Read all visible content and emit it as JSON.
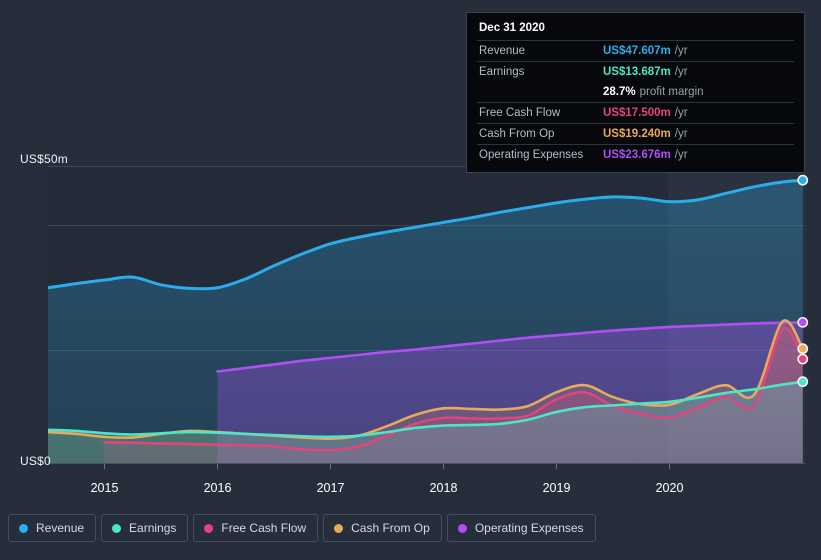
{
  "colors": {
    "background": "#262e3c",
    "plot_background": "#242b38",
    "forecast_background": "#2b3240",
    "gridline": "#3c4455",
    "revenue": "#2badeb",
    "earnings": "#4fe5c4",
    "free_cash_flow": "#e0457b",
    "cash_from_op": "#e8a95c",
    "operating_expenses": "#b14ef5",
    "tooltip_background": "#07080c",
    "tooltip_border": "#3b4253"
  },
  "y_axis": {
    "top_label": "US$50m",
    "zero_label": "US$0",
    "min": 0,
    "max": 50,
    "gridlines": [
      50,
      40,
      19,
      0
    ]
  },
  "x_axis": {
    "ticks": [
      "2015",
      "2016",
      "2017",
      "2018",
      "2019",
      "2020"
    ]
  },
  "tooltip": {
    "title": "Dec 31 2020",
    "rows": [
      {
        "key": "Revenue",
        "value": "US$47.607m",
        "unit": "/yr",
        "color": "#2badeb"
      },
      {
        "key": "Earnings",
        "value": "US$13.687m",
        "unit": "/yr",
        "color": "#4fe5c4"
      },
      {
        "key": "",
        "value": "28.7%",
        "unit": "profit margin",
        "color": "#ffffff"
      },
      {
        "key": "Free Cash Flow",
        "value": "US$17.500m",
        "unit": "/yr",
        "color": "#e0457b"
      },
      {
        "key": "Cash From Op",
        "value": "US$19.240m",
        "unit": "/yr",
        "color": "#e8a95c"
      },
      {
        "key": "Operating Expenses",
        "value": "US$23.676m",
        "unit": "/yr",
        "color": "#b14ef5"
      }
    ]
  },
  "legend": {
    "items": [
      {
        "label": "Revenue",
        "color": "#2badeb"
      },
      {
        "label": "Earnings",
        "color": "#4fe5c4"
      },
      {
        "label": "Free Cash Flow",
        "color": "#e0457b"
      },
      {
        "label": "Cash From Op",
        "color": "#e8a95c"
      },
      {
        "label": "Operating Expenses",
        "color": "#b14ef5"
      }
    ]
  },
  "chart_data": {
    "type": "area",
    "title": "",
    "xlabel": "",
    "ylabel": "US$",
    "ylim": [
      0,
      50
    ],
    "xlim": [
      2014.5,
      2021.2
    ],
    "grid": true,
    "legend_position": "bottom",
    "forecast_start": 2019.99,
    "series": [
      {
        "name": "Revenue",
        "color": "#2badeb",
        "x": [
          2014.5,
          2014.75,
          2015.0,
          2015.25,
          2015.5,
          2015.75,
          2016.0,
          2016.25,
          2016.5,
          2016.75,
          2017.0,
          2017.25,
          2017.5,
          2017.75,
          2018.0,
          2018.25,
          2018.5,
          2018.75,
          2019.0,
          2019.25,
          2019.5,
          2019.75,
          2020.0,
          2020.25,
          2020.5,
          2020.75,
          2021.0,
          2021.18
        ],
        "values": [
          29.5,
          30.2,
          30.8,
          31.3,
          30.0,
          29.4,
          29.5,
          31.0,
          33.2,
          35.2,
          36.9,
          38.0,
          38.9,
          39.7,
          40.5,
          41.3,
          42.2,
          43.0,
          43.8,
          44.4,
          44.8,
          44.6,
          44.0,
          44.3,
          45.4,
          46.5,
          47.3,
          47.607
        ]
      },
      {
        "name": "Operating Expenses",
        "color": "#b14ef5",
        "x": [
          2016.0,
          2016.25,
          2016.5,
          2016.75,
          2017.0,
          2017.25,
          2017.5,
          2017.75,
          2018.0,
          2018.25,
          2018.5,
          2018.75,
          2019.0,
          2019.25,
          2019.5,
          2019.75,
          2020.0,
          2020.25,
          2020.5,
          2020.75,
          2021.0,
          2021.18
        ],
        "values": [
          15.4,
          16.0,
          16.6,
          17.2,
          17.7,
          18.2,
          18.7,
          19.1,
          19.6,
          20.1,
          20.6,
          21.1,
          21.5,
          21.9,
          22.3,
          22.6,
          22.9,
          23.1,
          23.3,
          23.5,
          23.6,
          23.676
        ]
      },
      {
        "name": "Cash From Op",
        "color": "#e8a95c",
        "x": [
          2014.5,
          2014.75,
          2015.0,
          2015.25,
          2015.5,
          2015.75,
          2016.0,
          2016.25,
          2016.5,
          2016.75,
          2017.0,
          2017.25,
          2017.5,
          2017.75,
          2018.0,
          2018.25,
          2018.5,
          2018.75,
          2019.0,
          2019.25,
          2019.5,
          2019.75,
          2020.0,
          2020.25,
          2020.5,
          2020.75,
          2021.0,
          2021.18
        ],
        "values": [
          5.2,
          4.9,
          4.4,
          4.3,
          4.9,
          5.4,
          5.2,
          4.9,
          4.6,
          4.3,
          4.1,
          4.6,
          6.2,
          8.1,
          9.2,
          9.1,
          9.0,
          9.6,
          11.9,
          13.1,
          11.1,
          9.9,
          9.8,
          11.6,
          13.1,
          11.5,
          23.8,
          19.24
        ]
      },
      {
        "name": "Free Cash Flow",
        "color": "#e0457b",
        "x": [
          2015.0,
          2015.25,
          2015.5,
          2015.75,
          2016.0,
          2016.25,
          2016.5,
          2016.75,
          2017.0,
          2017.25,
          2017.5,
          2017.75,
          2018.0,
          2018.25,
          2018.5,
          2018.75,
          2019.0,
          2019.25,
          2019.5,
          2019.75,
          2020.0,
          2020.25,
          2020.5,
          2020.75,
          2021.0,
          2021.18
        ],
        "values": [
          3.5,
          3.4,
          3.3,
          3.2,
          3.1,
          3.0,
          2.8,
          2.3,
          2.2,
          2.8,
          4.6,
          6.6,
          7.6,
          7.5,
          7.5,
          8.0,
          10.7,
          11.9,
          9.6,
          8.3,
          7.7,
          9.3,
          11.2,
          9.7,
          22.5,
          17.5
        ]
      },
      {
        "name": "Earnings",
        "color": "#4fe5c4",
        "x": [
          2014.5,
          2014.75,
          2015.0,
          2015.25,
          2015.5,
          2015.75,
          2016.0,
          2016.25,
          2016.5,
          2016.75,
          2017.0,
          2017.25,
          2017.5,
          2017.75,
          2018.0,
          2018.25,
          2018.5,
          2018.75,
          2019.0,
          2019.25,
          2019.5,
          2019.75,
          2020.0,
          2020.25,
          2020.5,
          2020.75,
          2021.0,
          2021.18
        ],
        "values": [
          5.6,
          5.4,
          5.0,
          4.8,
          5.0,
          5.2,
          5.1,
          4.9,
          4.7,
          4.5,
          4.4,
          4.6,
          5.2,
          5.9,
          6.3,
          6.4,
          6.6,
          7.3,
          8.6,
          9.4,
          9.7,
          10.0,
          10.3,
          11.0,
          11.8,
          12.4,
          13.2,
          13.687
        ]
      }
    ]
  }
}
